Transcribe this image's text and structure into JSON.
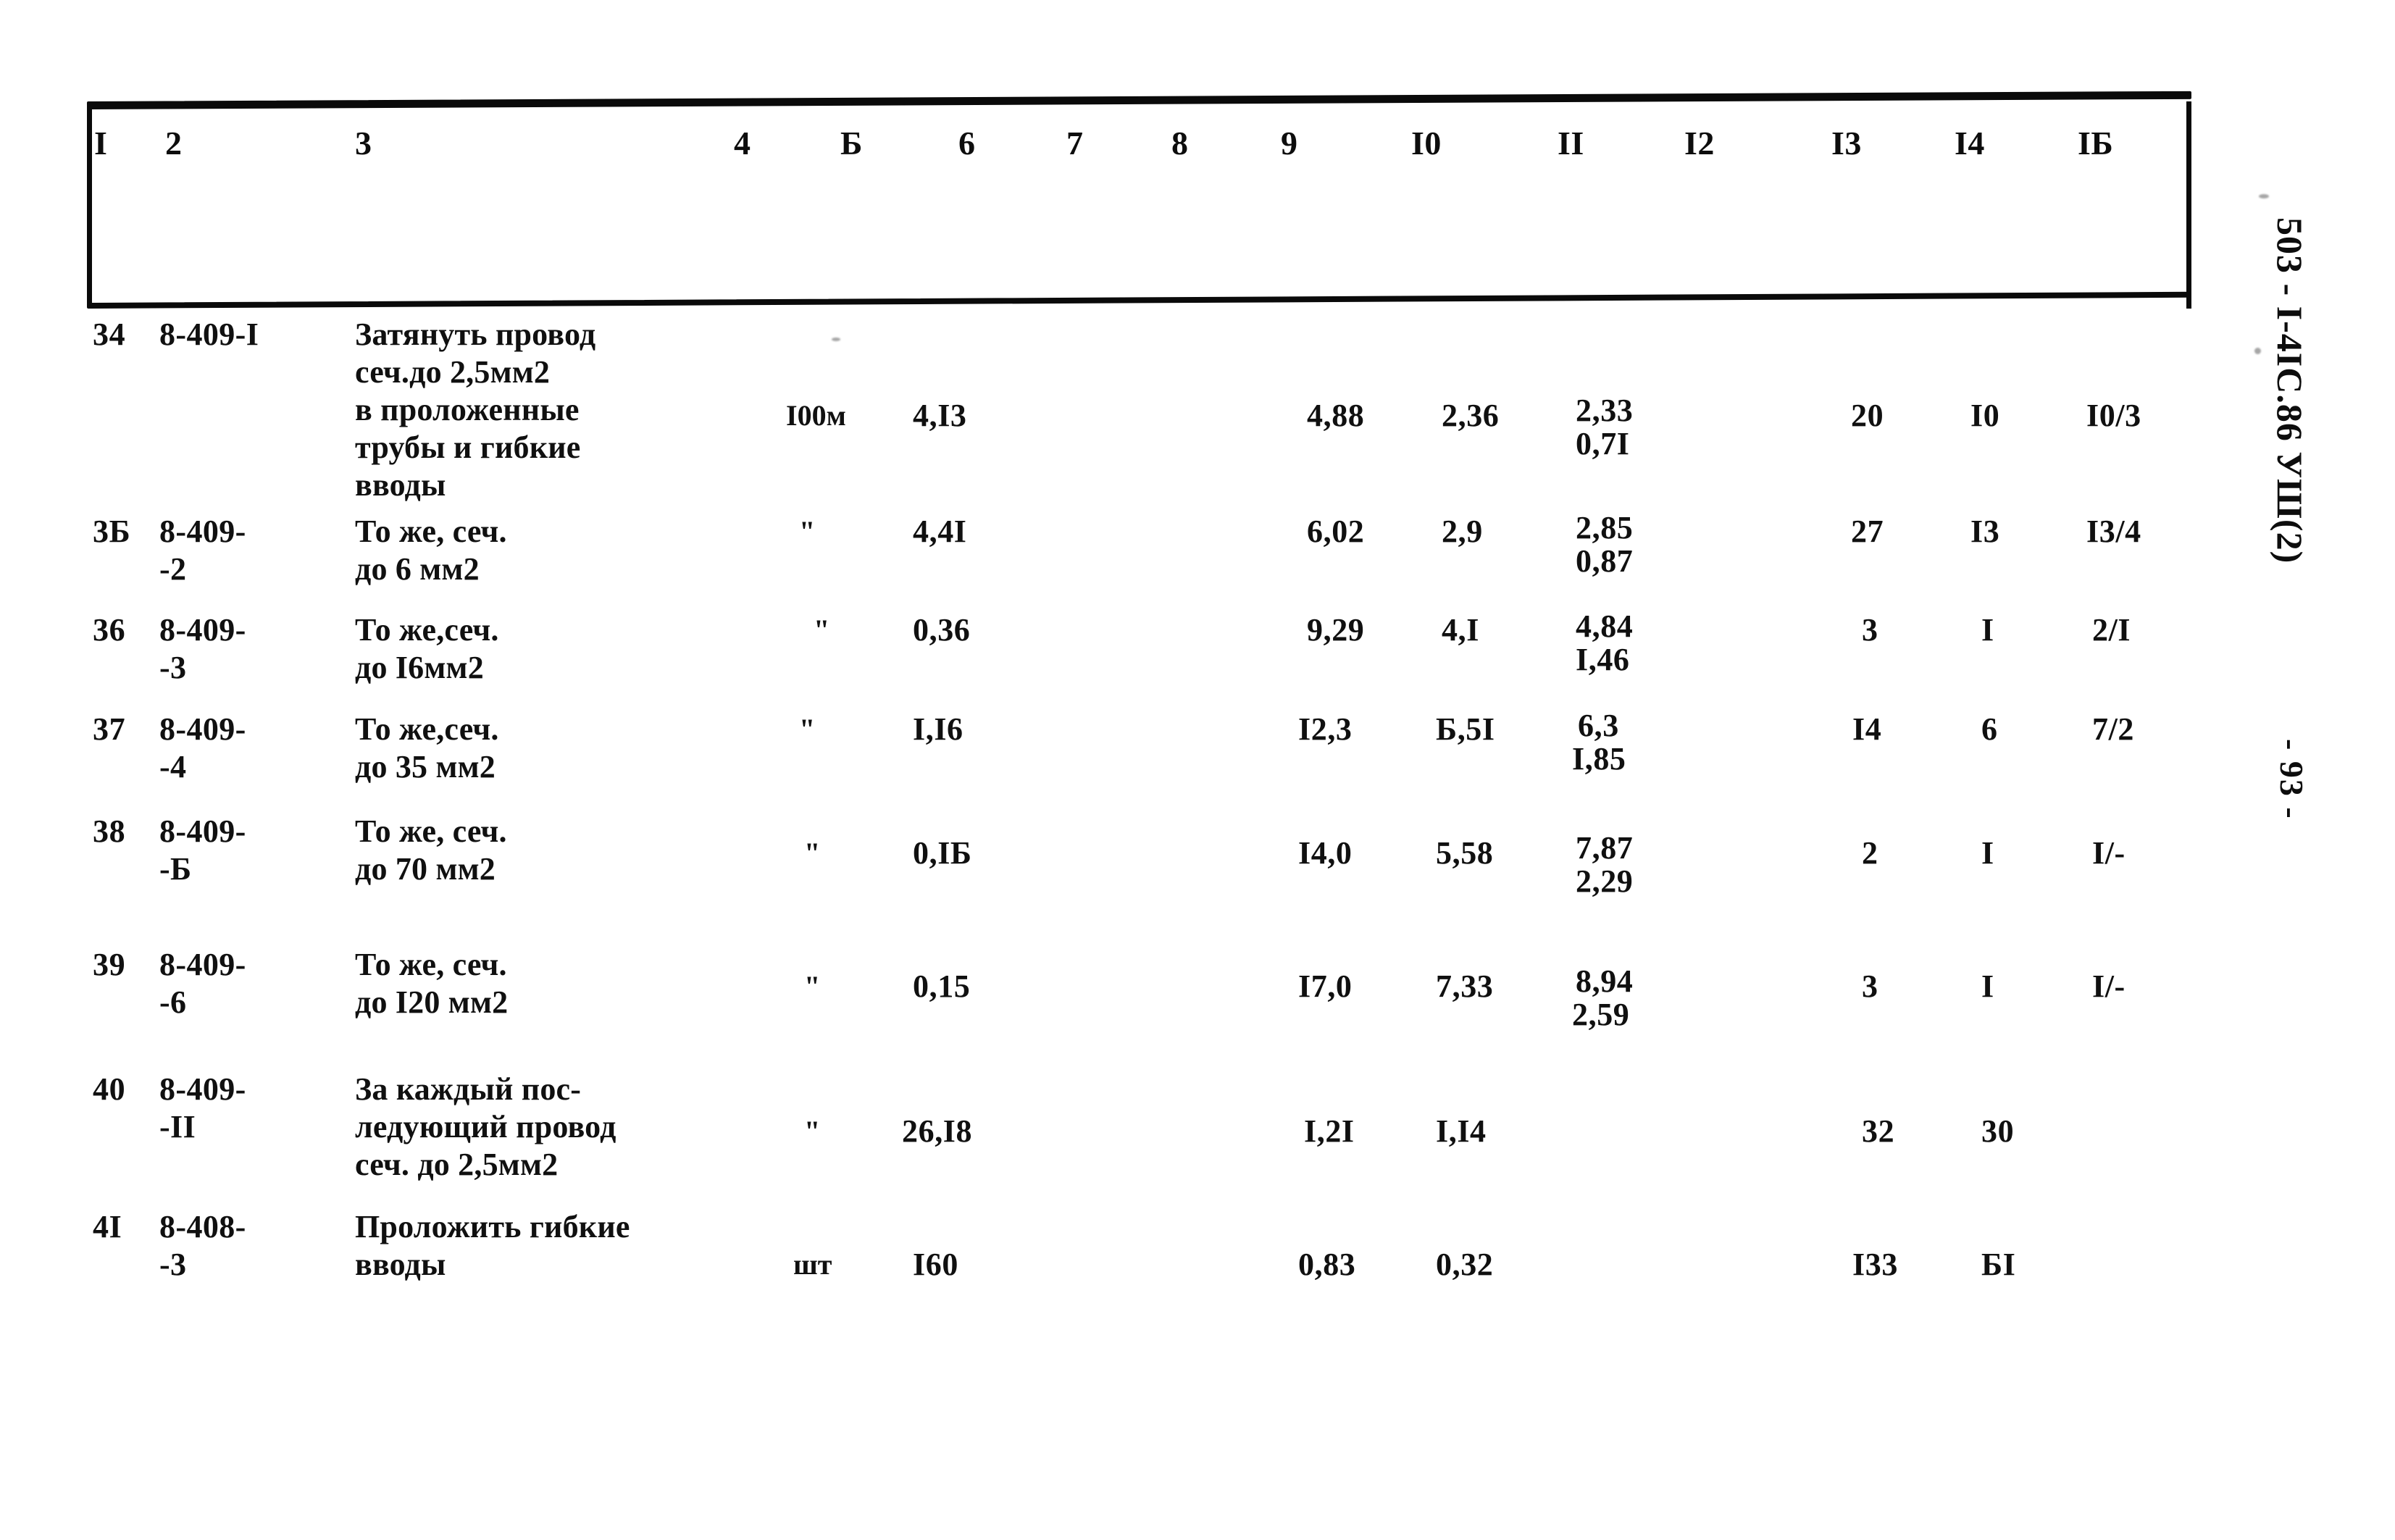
{
  "document": {
    "margin_code": "503 - I-4IC.86 УШ(2)",
    "page_label": "- 93 -"
  },
  "table": {
    "column_headers": [
      "I",
      "2",
      "3",
      "4",
      "Б",
      "6",
      "7",
      "8",
      "9",
      "I0",
      "II",
      "I2",
      "I3",
      "I4",
      "IБ"
    ],
    "rows": [
      {
        "num": "34",
        "code": "8-409-I",
        "description": "Затянуть провод\nсеч.до 2,5мм2\nв проложенные\nтрубы и гибкие\nвводы",
        "unit": "I00м",
        "qty": "4,I3",
        "c6": "",
        "c7": "",
        "c8": "",
        "c9": "4,88",
        "c10": "2,36",
        "c11_top": "2,33",
        "c11_bottom": "0,7I",
        "c12": "",
        "c13": "20",
        "c14": "I0",
        "c15": "I0/3"
      },
      {
        "num": "3Б",
        "code": "8-409-\n-2",
        "description": "То же, сеч.\nдо 6 мм2",
        "unit": "\"",
        "qty": "4,4I",
        "c6": "",
        "c7": "",
        "c8": "",
        "c9": "6,02",
        "c10": "2,9",
        "c11_top": "2,85",
        "c11_bottom": "0,87",
        "c12": "",
        "c13": "27",
        "c14": "I3",
        "c15": "I3/4"
      },
      {
        "num": "36",
        "code": "8-409-\n-3",
        "description": "То же,сеч.\nдо I6мм2",
        "unit": "\"",
        "qty": "0,36",
        "c6": "",
        "c7": "",
        "c8": "",
        "c9": "9,29",
        "c10": "4,I",
        "c11_top": "4,84",
        "c11_bottom": "I,46",
        "c12": "",
        "c13": "3",
        "c14": "I",
        "c15": "2/I"
      },
      {
        "num": "37",
        "code": "8-409-\n-4",
        "description": "То же,сеч.\nдо 35 мм2",
        "unit": "\"",
        "qty": "I,I6",
        "c6": "",
        "c7": "",
        "c8": "",
        "c9": "I2,3",
        "c10": "Б,5I",
        "c11_top": "6,3",
        "c11_bottom": "I,85",
        "c12": "",
        "c13": "I4",
        "c14": "6",
        "c15": "7/2"
      },
      {
        "num": "38",
        "code": "8-409-\n-Б",
        "description": "То же, сеч.\nдо 70 мм2",
        "unit": "\"",
        "qty": "0,IБ",
        "c6": "",
        "c7": "",
        "c8": "",
        "c9": "I4,0",
        "c10": "5,58",
        "c11_top": "7,87",
        "c11_bottom": "2,29",
        "c12": "",
        "c13": "2",
        "c14": "I",
        "c15": "I/-"
      },
      {
        "num": "39",
        "code": "8-409-\n-6",
        "description": "То же, сеч.\nдо I20 мм2",
        "unit": "\"",
        "qty": "0,15",
        "c6": "",
        "c7": "",
        "c8": "",
        "c9": "I7,0",
        "c10": "7,33",
        "c11_top": "8,94",
        "c11_bottom": "2,59",
        "c12": "",
        "c13": "3",
        "c14": "I",
        "c15": "I/-"
      },
      {
        "num": "40",
        "code": "8-409-\n-II",
        "description": "За каждый пос-\nледующий провод\nсеч. до 2,5мм2",
        "unit": "\"",
        "qty": "26,I8",
        "c6": "",
        "c7": "",
        "c8": "",
        "c9": "I,2I",
        "c10": "I,I4",
        "c11_top": "",
        "c11_bottom": "",
        "c12": "",
        "c13": "32",
        "c14": "30",
        "c15": ""
      },
      {
        "num": "4I",
        "code": "8-408-\n-3",
        "description": "Проложить гибкие\nвводы",
        "unit": "шт",
        "qty": "I60",
        "c6": "",
        "c7": "",
        "c8": "",
        "c9": "0,83",
        "c10": "0,32",
        "c11_top": "",
        "c11_bottom": "",
        "c12": "",
        "c13": "I33",
        "c14": "БI",
        "c15": ""
      }
    ]
  }
}
